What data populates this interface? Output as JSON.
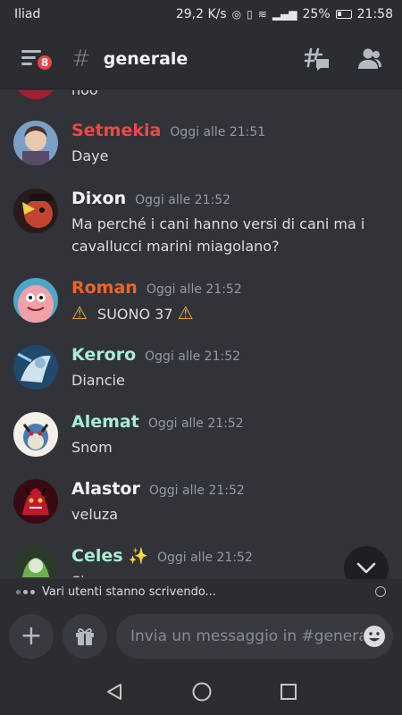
{
  "status_bar": {
    "carrier": "Iliad",
    "speed": "29,2 K/s",
    "battery": "25%",
    "time": "21:58"
  },
  "header": {
    "badge_count": "8",
    "channel": "generale",
    "hash": "#"
  },
  "messages": [
    {
      "cut_text": "noo"
    },
    {
      "username": "Setmekia",
      "color": "#f04747",
      "time": "Oggi alle 21:51",
      "text": "Daye"
    },
    {
      "username": "Dixon",
      "color": "#f2f3f5",
      "time": "Oggi alle 21:52",
      "text": "Ma perché i cani hanno versi di cani ma i cavallucci marini miagolano?"
    },
    {
      "username": "Roman",
      "color": "#f26522",
      "time": "Oggi alle 21:52",
      "text": "SUONO 37"
    },
    {
      "username": "Keroro",
      "color": "#a6eed4",
      "time": "Oggi alle 21:52",
      "text": "Diancie"
    },
    {
      "username": "Alemat",
      "color": "#a6eed4",
      "time": "Oggi alle 21:52",
      "text": "Snom"
    },
    {
      "username": "Alastor",
      "color": "#f2f3f5",
      "time": "Oggi alle 21:52",
      "text": "veluza"
    },
    {
      "username": "Celes",
      "color": "#a6eed4",
      "time": "Oggi alle 21:52",
      "text": "Sh"
    }
  ],
  "typing_indicator": "Vari utenti stanno scrivendo...",
  "composer": {
    "placeholder": "Invia un messaggio in #generale"
  },
  "icons": {
    "menu": "hamburger-menu-icon",
    "threads": "threads-icon",
    "members": "members-icon",
    "gift": "gift-icon",
    "emoji": "emoji-icon",
    "scroll": "chevron-down-icon"
  }
}
